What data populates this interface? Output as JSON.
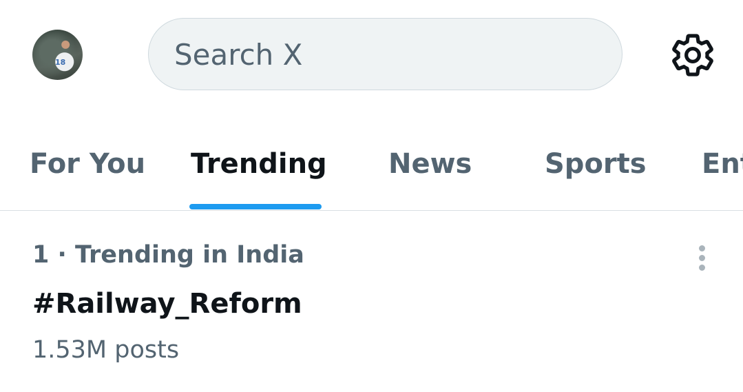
{
  "header": {
    "avatar": {
      "jersey_number": "18"
    },
    "search": {
      "placeholder": "Search X"
    },
    "settings_icon": "gear-icon"
  },
  "tabs": [
    {
      "label": "For You",
      "active": false
    },
    {
      "label": "Trending",
      "active": true
    },
    {
      "label": "News",
      "active": false
    },
    {
      "label": "Sports",
      "active": false
    },
    {
      "label": "Ent",
      "active": false
    }
  ],
  "trends": [
    {
      "meta": "1 · Trending in India",
      "name": "#Railway_Reform",
      "posts": "1.53M posts"
    }
  ],
  "colors": {
    "accent": "#1d9bf0",
    "text_primary": "#0f1419",
    "text_secondary": "#536471",
    "search_bg": "#eff3f4"
  }
}
